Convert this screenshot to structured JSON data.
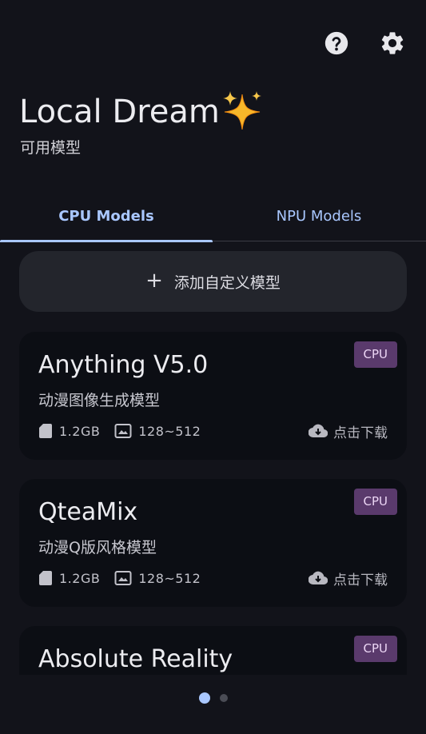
{
  "header": {
    "app_title": "Local Dream",
    "subtitle": "可用模型",
    "help_icon": "help-circle-icon",
    "settings_icon": "gear-icon"
  },
  "tabs": [
    {
      "label": "CPU Models",
      "selected": true
    },
    {
      "label": "NPU Models",
      "selected": false
    }
  ],
  "add_button": {
    "label": "添加自定义模型"
  },
  "models": [
    {
      "name": "Anything V5.0",
      "description": "动漫图像生成模型",
      "badge": "CPU",
      "size": "1.2GB",
      "resolution": "128~512",
      "action": "点击下载"
    },
    {
      "name": "QteaMix",
      "description": "动漫Q版风格模型",
      "badge": "CPU",
      "size": "1.2GB",
      "resolution": "128~512",
      "action": "点击下载"
    },
    {
      "name": "Absolute Reality",
      "badge": "CPU"
    }
  ],
  "pager": {
    "page_count": 2,
    "current_page": 1
  },
  "colors": {
    "accent": "#a9c7ff",
    "badge_bg": "#5a3a6c",
    "background": "#12131a",
    "card": "#0c0e14"
  }
}
